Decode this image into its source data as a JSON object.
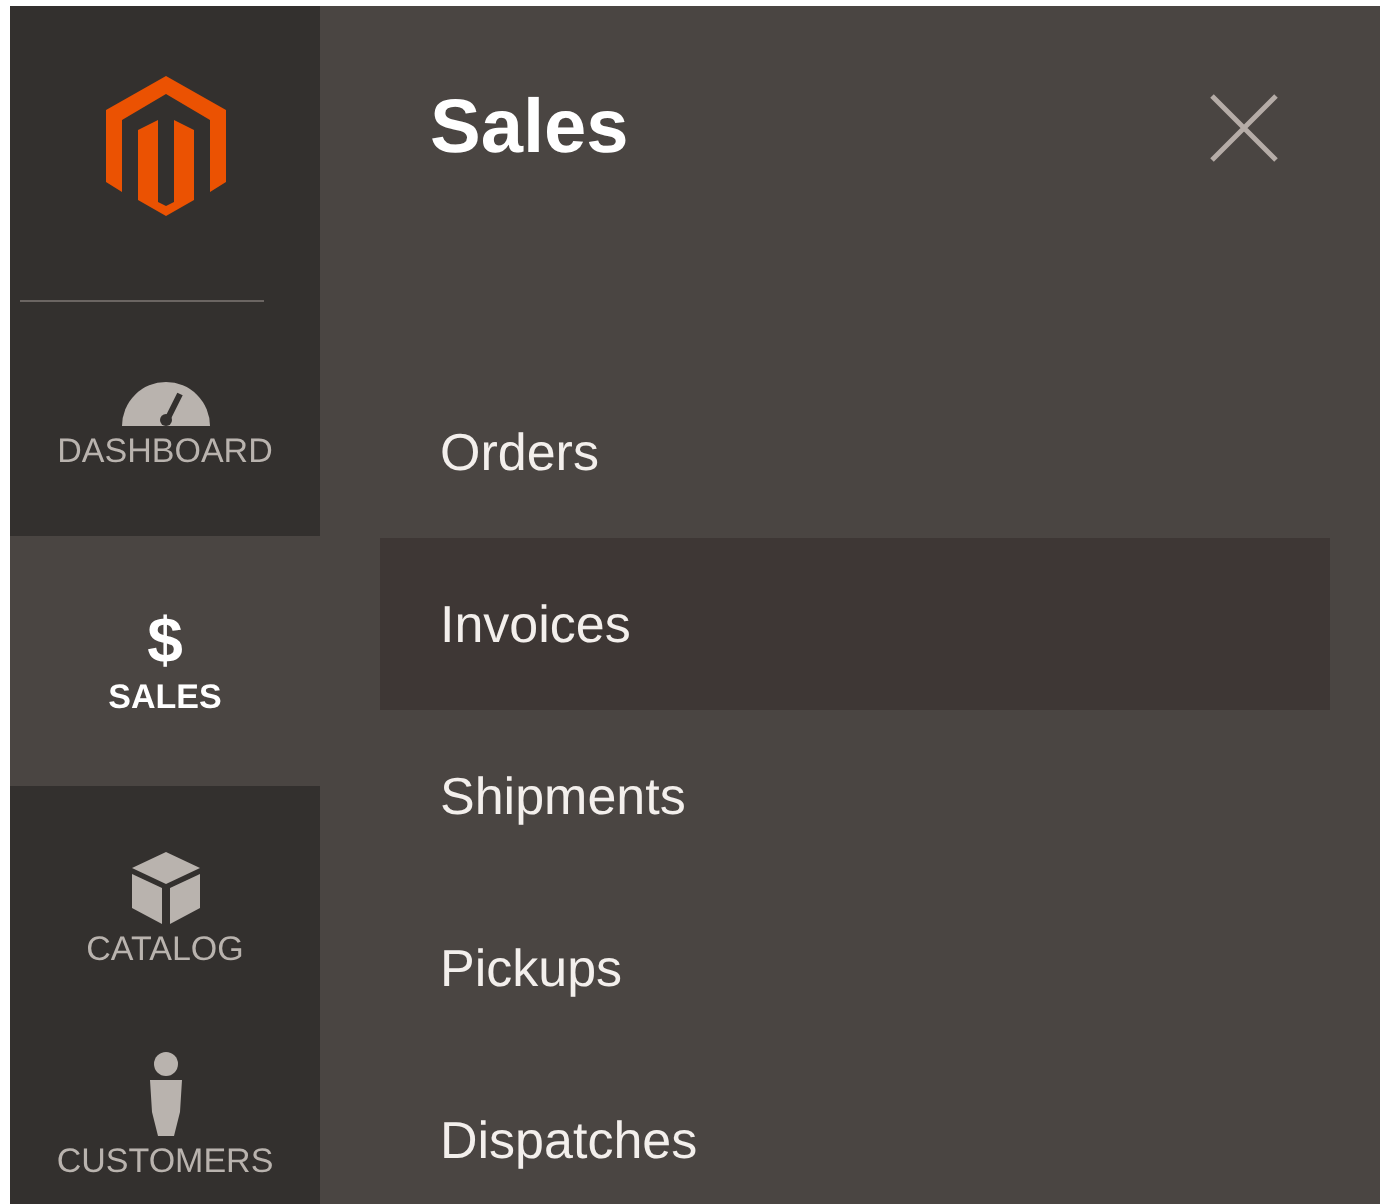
{
  "sidebar": {
    "items": [
      {
        "kind": "gauge",
        "label": "DASHBOARD",
        "selected": false
      },
      {
        "kind": "glyph",
        "glyph": "$",
        "label": "SALES",
        "selected": true
      },
      {
        "kind": "box",
        "label": "CATALOG",
        "selected": false
      },
      {
        "kind": "person",
        "label": "CUSTOMERS",
        "selected": false
      }
    ]
  },
  "panel": {
    "title": "Sales",
    "items": [
      {
        "label": "Orders",
        "selected": false
      },
      {
        "label": "Invoices",
        "selected": true
      },
      {
        "label": "Shipments",
        "selected": false
      },
      {
        "label": "Pickups",
        "selected": false
      },
      {
        "label": "Dispatches",
        "selected": false
      }
    ]
  }
}
